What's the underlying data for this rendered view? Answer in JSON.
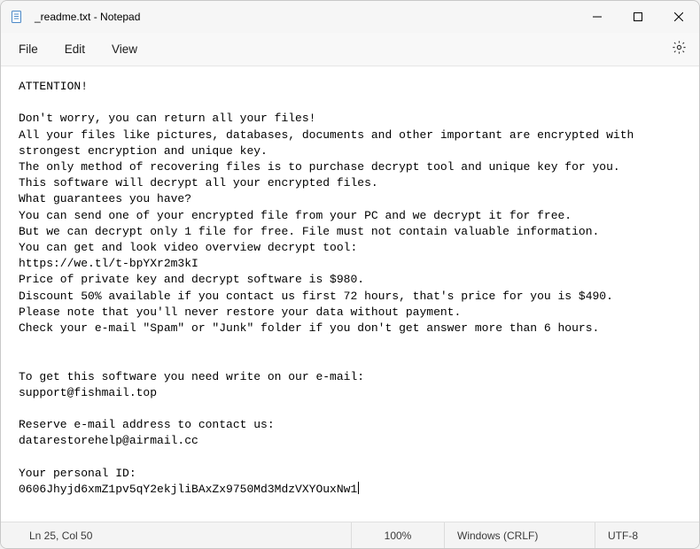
{
  "window": {
    "title": "_readme.txt - Notepad"
  },
  "menu": {
    "file": "File",
    "edit": "Edit",
    "view": "View"
  },
  "document": {
    "text": "ATTENTION!\n\nDon't worry, you can return all your files!\nAll your files like pictures, databases, documents and other important are encrypted with strongest encryption and unique key.\nThe only method of recovering files is to purchase decrypt tool and unique key for you.\nThis software will decrypt all your encrypted files.\nWhat guarantees you have?\nYou can send one of your encrypted file from your PC and we decrypt it for free.\nBut we can decrypt only 1 file for free. File must not contain valuable information.\nYou can get and look video overview decrypt tool:\nhttps://we.tl/t-bpYXr2m3kI\nPrice of private key and decrypt software is $980.\nDiscount 50% available if you contact us first 72 hours, that's price for you is $490.\nPlease note that you'll never restore your data without payment.\nCheck your e-mail \"Spam\" or \"Junk\" folder if you don't get answer more than 6 hours.\n\n\nTo get this software you need write on our e-mail:\nsupport@fishmail.top\n\nReserve e-mail address to contact us:\ndatarestorehelp@airmail.cc\n\nYour personal ID:\n0606Jhyjd6xmZ1pv5qY2ekjliBAxZx9750Md3MdzVXYOuxNw1"
  },
  "status": {
    "position": "Ln 25, Col 50",
    "zoom": "100%",
    "line_ending": "Windows (CRLF)",
    "encoding": "UTF-8"
  }
}
